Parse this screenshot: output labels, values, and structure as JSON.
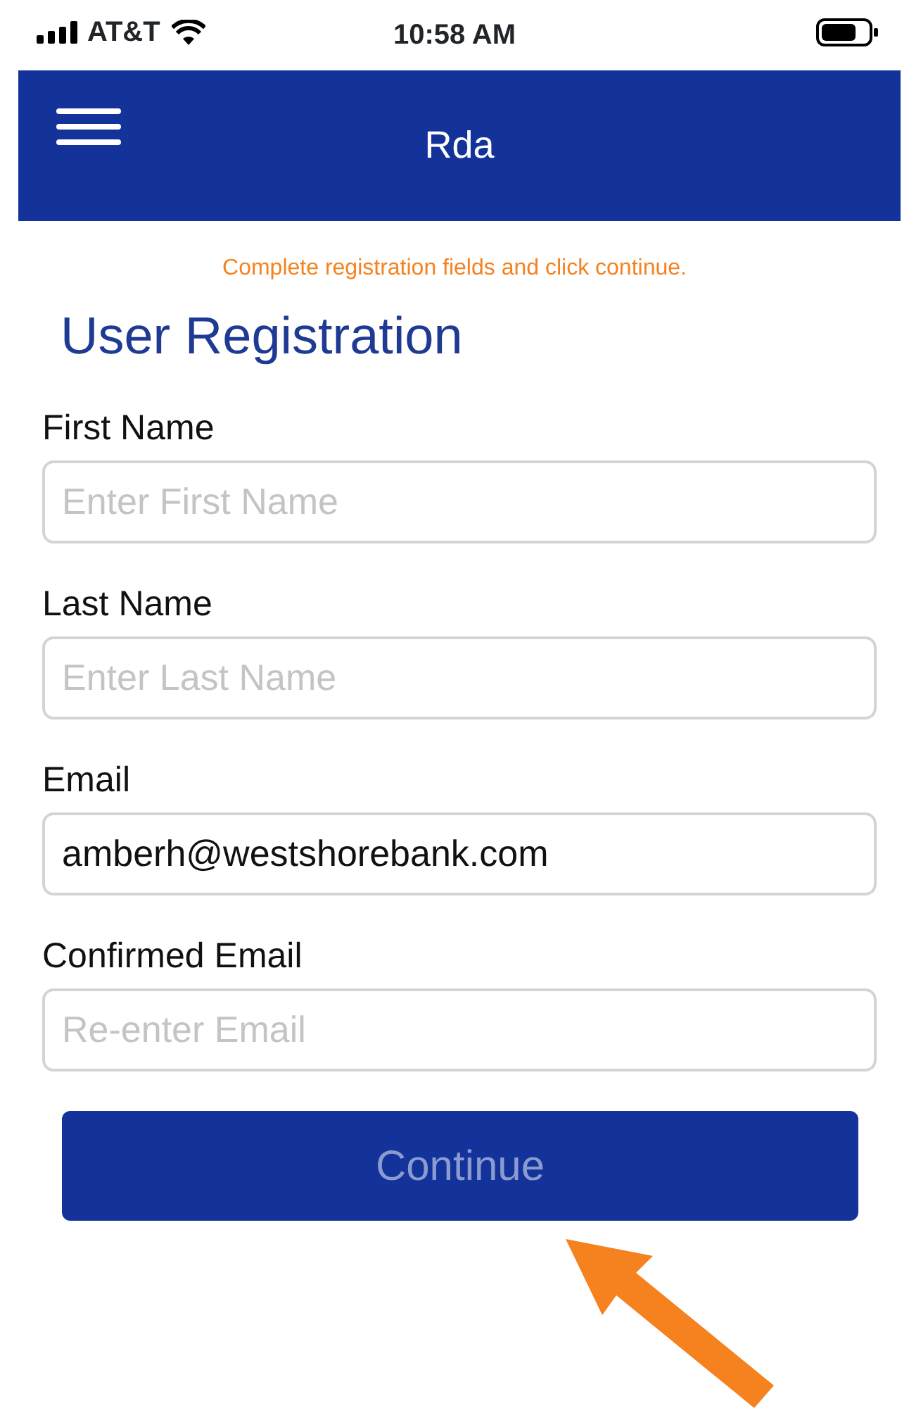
{
  "status_bar": {
    "carrier": "AT&T",
    "time": "10:58 AM"
  },
  "header": {
    "title": "Rda"
  },
  "hint": "Complete registration fields and click continue.",
  "title": "User Registration",
  "fields": [
    {
      "label": "First Name",
      "placeholder": "Enter First Name"
    },
    {
      "label": "Last Name",
      "placeholder": "Enter Last Name"
    },
    {
      "label": "Email",
      "value": "amberh@westshorebank.com"
    },
    {
      "label": "Confirmed Email",
      "placeholder": "Re-enter Email"
    }
  ],
  "continue_button": {
    "label": "Continue",
    "disabled": true
  }
}
